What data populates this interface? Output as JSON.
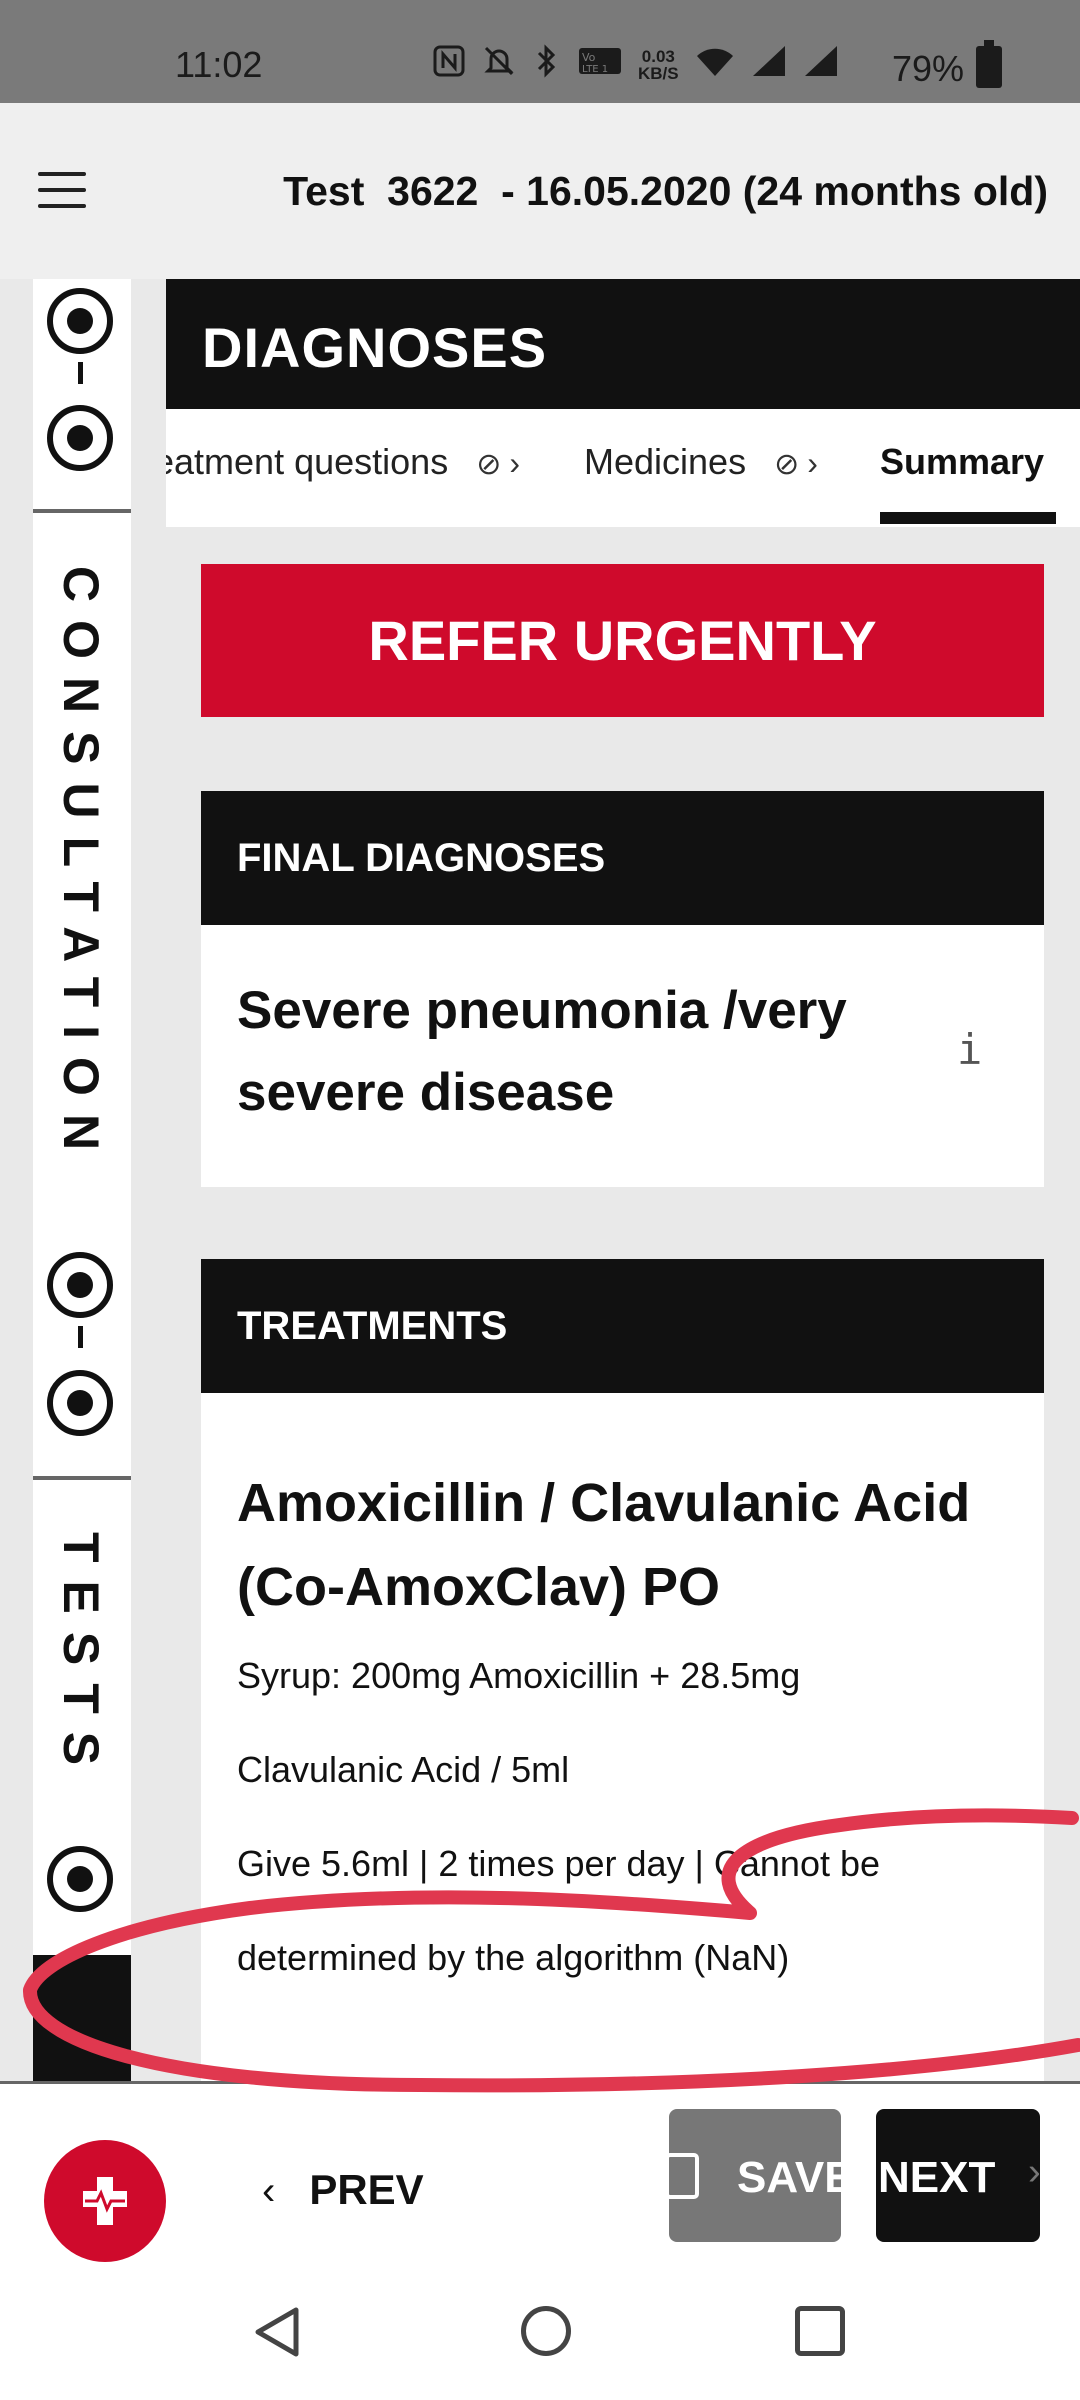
{
  "status_bar": {
    "time": "11:02",
    "net_speed_value": "0.03",
    "net_speed_unit": "KB/S",
    "battery": "79%",
    "icons": [
      "nfc-icon",
      "mute-icon",
      "bluetooth-icon",
      "volte-icon",
      "wifi-icon",
      "signal-icon",
      "signal-icon",
      "battery-icon"
    ]
  },
  "header": {
    "title": "Test  3622  - 16.05.2020 (24 months old)"
  },
  "sidebar": {
    "consultation_label": "CONSULTATION",
    "tests_label": "TESTS"
  },
  "section": {
    "title": "DIAGNOSES"
  },
  "steps": [
    {
      "label": "eatment questions",
      "done": true
    },
    {
      "label": "Medicines",
      "done": true
    },
    {
      "label": "Summary",
      "active": true
    }
  ],
  "refer_button": "REFER URGENTLY",
  "final_diagnoses": {
    "heading": "FINAL DIAGNOSES",
    "items": [
      "Severe pneumonia /very severe disease"
    ],
    "info_icon": "i"
  },
  "treatments": {
    "heading": "TREATMENTS",
    "drug_name": "Amoxicillin / Clavulanic Acid (Co-AmoxClav) PO",
    "lines": [
      "Syrup: 200mg Amoxicillin + 28.5mg",
      "Clavulanic Acid / 5ml",
      "Give 5.6ml | 2 times per day | Cannot be",
      "determined by the algorithm (NaN)"
    ]
  },
  "bottom_bar": {
    "prev_label": "PREV",
    "save_label": "SAVE",
    "next_label": "NEXT"
  },
  "colors": {
    "accent_red": "#cf0a2c",
    "dark": "#111111",
    "annotation_red": "#e0384f"
  }
}
